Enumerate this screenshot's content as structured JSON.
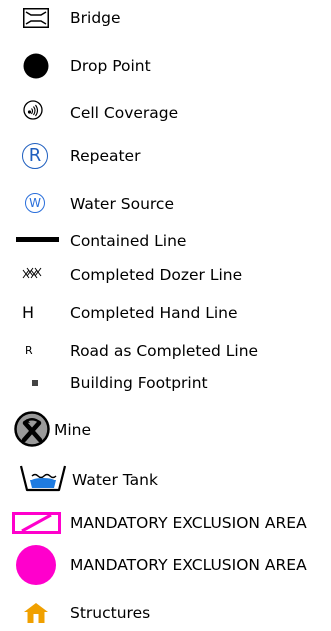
{
  "legend": {
    "items": [
      {
        "label": "Bridge",
        "icon": "bridge-icon"
      },
      {
        "label": "Drop Point",
        "icon": "drop-point-icon"
      },
      {
        "label": "Cell Coverage",
        "icon": "cell-coverage-icon"
      },
      {
        "label": "Repeater",
        "icon": "repeater-icon",
        "symbol_text": "R"
      },
      {
        "label": "Water Source",
        "icon": "water-source-icon",
        "symbol_text": "W"
      },
      {
        "label": "Contained Line",
        "icon": "contained-line-icon"
      },
      {
        "label": "Completed Dozer Line",
        "icon": "dozer-line-icon"
      },
      {
        "label": "Completed Hand Line",
        "icon": "hand-line-icon",
        "symbol_text": "H"
      },
      {
        "label": "Road as Completed Line",
        "icon": "road-line-icon",
        "symbol_text": "R"
      },
      {
        "label": "Building Footprint",
        "icon": "building-footprint-icon"
      },
      {
        "label": "Mine",
        "icon": "mine-icon"
      },
      {
        "label": "Water Tank",
        "icon": "water-tank-icon"
      },
      {
        "label": "MANDATORY EXCLUSION AREA",
        "icon": "exclusion-area-polygon-icon"
      },
      {
        "label": "MANDATORY EXCLUSION AREA",
        "icon": "exclusion-area-point-icon"
      },
      {
        "label": "Structures",
        "icon": "structures-icon"
      }
    ]
  },
  "colors": {
    "text": "#000000",
    "repeater_blue": "#1f5fbf",
    "water_source_blue": "#2a6fdb",
    "magenta": "#ff00cc",
    "tank_blue": "#1e7be0",
    "structure_orange": "#f0a000",
    "mine_gray": "#9a9a9a"
  }
}
